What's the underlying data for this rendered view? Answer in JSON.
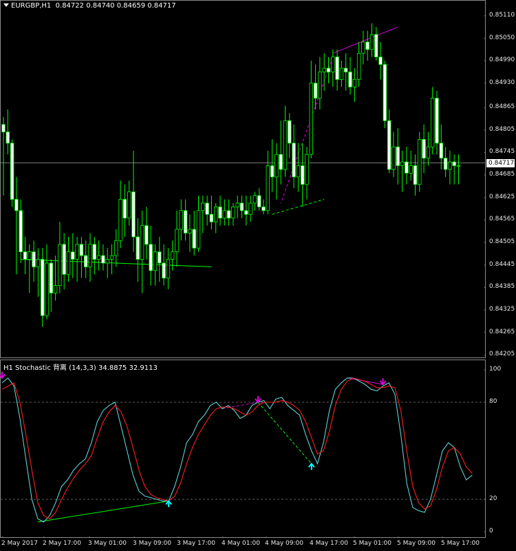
{
  "main_window": {
    "symbol": "EURGBP,H1",
    "ohlc": "0.84722 0.84740 0.84659 0.84717",
    "current_price": "0.84717",
    "price_axis": [
      "0.85110",
      "0.85050",
      "0.84990",
      "0.84930",
      "0.84865",
      "0.84805",
      "0.84745",
      "0.84685",
      "0.84625",
      "0.84565",
      "0.84505",
      "0.84445",
      "0.84385",
      "0.84325",
      "0.84265",
      "0.84205"
    ]
  },
  "indicator_window": {
    "title": "H1 Stochastic 背离 (14,3,3) 34.8875 32.9113",
    "levels": [
      "100",
      "80",
      "20",
      "0"
    ]
  },
  "time_axis": [
    "2 May 2017",
    "2 May 17:00",
    "3 May 01:00",
    "3 May 09:00",
    "3 May 17:00",
    "4 May 01:00",
    "4 May 09:00",
    "4 May 17:00",
    "5 May 01:00",
    "5 May 09:00",
    "5 May 17:00"
  ],
  "colors": {
    "background": "#000000",
    "candle_outline": "#00ff00",
    "candle_bull_fill": "#000000",
    "candle_bear_fill": "#ffffff",
    "stoch_main": "#5fd3d3",
    "stoch_signal": "#ff2020",
    "bearish_divergence": "#e000e0",
    "bullish_divergence": "#00ff00",
    "bullish_arrow": "#00ffff"
  },
  "chart_data": [
    {
      "type": "candlestick",
      "title": "EURGBP,H1",
      "ylim": [
        0.842,
        0.8513
      ],
      "candles": [
        {
          "o": 0.8482,
          "h": 0.8484,
          "l": 0.8463,
          "c": 0.848
        },
        {
          "o": 0.848,
          "h": 0.8486,
          "l": 0.8474,
          "c": 0.8477
        },
        {
          "o": 0.8477,
          "h": 0.8478,
          "l": 0.846,
          "c": 0.8462
        },
        {
          "o": 0.8462,
          "h": 0.8468,
          "l": 0.8442,
          "c": 0.8459
        },
        {
          "o": 0.8459,
          "h": 0.8462,
          "l": 0.8445,
          "c": 0.8448
        },
        {
          "o": 0.8448,
          "h": 0.8452,
          "l": 0.8442,
          "c": 0.8446
        },
        {
          "o": 0.8446,
          "h": 0.845,
          "l": 0.8437,
          "c": 0.8448
        },
        {
          "o": 0.8448,
          "h": 0.8451,
          "l": 0.844,
          "c": 0.8444
        },
        {
          "o": 0.8444,
          "h": 0.8449,
          "l": 0.8436,
          "c": 0.8446
        },
        {
          "o": 0.8446,
          "h": 0.8449,
          "l": 0.8428,
          "c": 0.8431
        },
        {
          "o": 0.8431,
          "h": 0.845,
          "l": 0.843,
          "c": 0.8445
        },
        {
          "o": 0.8445,
          "h": 0.8446,
          "l": 0.8432,
          "c": 0.8437
        },
        {
          "o": 0.8437,
          "h": 0.8447,
          "l": 0.8435,
          "c": 0.8439
        },
        {
          "o": 0.8439,
          "h": 0.8456,
          "l": 0.8437,
          "c": 0.845
        },
        {
          "o": 0.845,
          "h": 0.8453,
          "l": 0.8438,
          "c": 0.8442
        },
        {
          "o": 0.8442,
          "h": 0.8452,
          "l": 0.844,
          "c": 0.8448
        },
        {
          "o": 0.8448,
          "h": 0.8453,
          "l": 0.8441,
          "c": 0.8446
        },
        {
          "o": 0.8446,
          "h": 0.8452,
          "l": 0.844,
          "c": 0.845
        },
        {
          "o": 0.845,
          "h": 0.8452,
          "l": 0.8441,
          "c": 0.8447
        },
        {
          "o": 0.8447,
          "h": 0.8451,
          "l": 0.8441,
          "c": 0.8444
        },
        {
          "o": 0.8444,
          "h": 0.8453,
          "l": 0.844,
          "c": 0.845
        },
        {
          "o": 0.845,
          "h": 0.8452,
          "l": 0.8442,
          "c": 0.8446
        },
        {
          "o": 0.8446,
          "h": 0.8451,
          "l": 0.8443,
          "c": 0.8447
        },
        {
          "o": 0.8447,
          "h": 0.845,
          "l": 0.8443,
          "c": 0.8445
        },
        {
          "o": 0.8445,
          "h": 0.8449,
          "l": 0.8441,
          "c": 0.8446
        },
        {
          "o": 0.8446,
          "h": 0.845,
          "l": 0.8442,
          "c": 0.8447
        },
        {
          "o": 0.8447,
          "h": 0.8454,
          "l": 0.8444,
          "c": 0.8451
        },
        {
          "o": 0.8451,
          "h": 0.8467,
          "l": 0.8449,
          "c": 0.8462
        },
        {
          "o": 0.8462,
          "h": 0.8466,
          "l": 0.8452,
          "c": 0.8457
        },
        {
          "o": 0.8457,
          "h": 0.8467,
          "l": 0.8455,
          "c": 0.8464
        },
        {
          "o": 0.8464,
          "h": 0.8475,
          "l": 0.8448,
          "c": 0.8452
        },
        {
          "o": 0.8452,
          "h": 0.8457,
          "l": 0.844,
          "c": 0.8446
        },
        {
          "o": 0.8446,
          "h": 0.8459,
          "l": 0.8437,
          "c": 0.8455
        },
        {
          "o": 0.8455,
          "h": 0.846,
          "l": 0.8446,
          "c": 0.845
        },
        {
          "o": 0.845,
          "h": 0.8455,
          "l": 0.8439,
          "c": 0.8443
        },
        {
          "o": 0.8443,
          "h": 0.845,
          "l": 0.8439,
          "c": 0.8448
        },
        {
          "o": 0.8448,
          "h": 0.8452,
          "l": 0.844,
          "c": 0.8445
        },
        {
          "o": 0.8445,
          "h": 0.845,
          "l": 0.8439,
          "c": 0.8441
        },
        {
          "o": 0.8441,
          "h": 0.8449,
          "l": 0.8438,
          "c": 0.8446
        },
        {
          "o": 0.8446,
          "h": 0.8451,
          "l": 0.8443,
          "c": 0.8448
        },
        {
          "o": 0.8448,
          "h": 0.8459,
          "l": 0.8444,
          "c": 0.8454
        },
        {
          "o": 0.8454,
          "h": 0.8462,
          "l": 0.8451,
          "c": 0.8459
        },
        {
          "o": 0.8459,
          "h": 0.8462,
          "l": 0.8451,
          "c": 0.8453
        },
        {
          "o": 0.8453,
          "h": 0.8458,
          "l": 0.8448,
          "c": 0.8454
        },
        {
          "o": 0.8454,
          "h": 0.8459,
          "l": 0.8447,
          "c": 0.8449
        },
        {
          "o": 0.8449,
          "h": 0.8463,
          "l": 0.8448,
          "c": 0.8459
        },
        {
          "o": 0.8459,
          "h": 0.8463,
          "l": 0.8453,
          "c": 0.8461
        },
        {
          "o": 0.8461,
          "h": 0.8463,
          "l": 0.8455,
          "c": 0.8458
        },
        {
          "o": 0.8458,
          "h": 0.8463,
          "l": 0.8454,
          "c": 0.8456
        },
        {
          "o": 0.8456,
          "h": 0.8461,
          "l": 0.8453,
          "c": 0.846
        },
        {
          "o": 0.846,
          "h": 0.8463,
          "l": 0.8455,
          "c": 0.8457
        },
        {
          "o": 0.8457,
          "h": 0.8462,
          "l": 0.8455,
          "c": 0.8459
        },
        {
          "o": 0.8459,
          "h": 0.8462,
          "l": 0.8455,
          "c": 0.8457
        },
        {
          "o": 0.8457,
          "h": 0.8461,
          "l": 0.8455,
          "c": 0.846
        },
        {
          "o": 0.846,
          "h": 0.8463,
          "l": 0.8457,
          "c": 0.8461
        },
        {
          "o": 0.8461,
          "h": 0.8463,
          "l": 0.8457,
          "c": 0.8459
        },
        {
          "o": 0.8459,
          "h": 0.8463,
          "l": 0.8455,
          "c": 0.8458
        },
        {
          "o": 0.8458,
          "h": 0.8463,
          "l": 0.8456,
          "c": 0.8461
        },
        {
          "o": 0.8461,
          "h": 0.8464,
          "l": 0.8459,
          "c": 0.8463
        },
        {
          "o": 0.8463,
          "h": 0.8465,
          "l": 0.8459,
          "c": 0.846
        },
        {
          "o": 0.846,
          "h": 0.8462,
          "l": 0.8458,
          "c": 0.8459
        },
        {
          "o": 0.8459,
          "h": 0.8475,
          "l": 0.8458,
          "c": 0.8471
        },
        {
          "o": 0.8471,
          "h": 0.8478,
          "l": 0.8464,
          "c": 0.8468
        },
        {
          "o": 0.8468,
          "h": 0.8477,
          "l": 0.8462,
          "c": 0.8474
        },
        {
          "o": 0.8474,
          "h": 0.8483,
          "l": 0.8466,
          "c": 0.847
        },
        {
          "o": 0.847,
          "h": 0.8487,
          "l": 0.8468,
          "c": 0.8483
        },
        {
          "o": 0.8483,
          "h": 0.8485,
          "l": 0.8473,
          "c": 0.8477
        },
        {
          "o": 0.8477,
          "h": 0.8482,
          "l": 0.8465,
          "c": 0.8468
        },
        {
          "o": 0.8468,
          "h": 0.8477,
          "l": 0.8464,
          "c": 0.8471
        },
        {
          "o": 0.8471,
          "h": 0.8477,
          "l": 0.846,
          "c": 0.8466
        },
        {
          "o": 0.8466,
          "h": 0.8476,
          "l": 0.8462,
          "c": 0.8474
        },
        {
          "o": 0.8474,
          "h": 0.8499,
          "l": 0.8473,
          "c": 0.8493
        },
        {
          "o": 0.8493,
          "h": 0.8498,
          "l": 0.8486,
          "c": 0.8489
        },
        {
          "o": 0.8489,
          "h": 0.85,
          "l": 0.8486,
          "c": 0.8496
        },
        {
          "o": 0.8496,
          "h": 0.8501,
          "l": 0.8491,
          "c": 0.8497
        },
        {
          "o": 0.8497,
          "h": 0.85,
          "l": 0.8493,
          "c": 0.8496
        },
        {
          "o": 0.8496,
          "h": 0.8502,
          "l": 0.8492,
          "c": 0.85
        },
        {
          "o": 0.85,
          "h": 0.8502,
          "l": 0.8491,
          "c": 0.8494
        },
        {
          "o": 0.8494,
          "h": 0.8499,
          "l": 0.8492,
          "c": 0.8497
        },
        {
          "o": 0.8497,
          "h": 0.8501,
          "l": 0.8491,
          "c": 0.8496
        },
        {
          "o": 0.8496,
          "h": 0.85,
          "l": 0.849,
          "c": 0.8492
        },
        {
          "o": 0.8492,
          "h": 0.8497,
          "l": 0.8488,
          "c": 0.8494
        },
        {
          "o": 0.8494,
          "h": 0.8504,
          "l": 0.8492,
          "c": 0.8501
        },
        {
          "o": 0.8501,
          "h": 0.8507,
          "l": 0.8498,
          "c": 0.8504
        },
        {
          "o": 0.8504,
          "h": 0.8507,
          "l": 0.8499,
          "c": 0.8502
        },
        {
          "o": 0.8502,
          "h": 0.8509,
          "l": 0.85,
          "c": 0.8506
        },
        {
          "o": 0.8506,
          "h": 0.8508,
          "l": 0.8499,
          "c": 0.85
        },
        {
          "o": 0.85,
          "h": 0.8504,
          "l": 0.8494,
          "c": 0.8498
        },
        {
          "o": 0.8498,
          "h": 0.8499,
          "l": 0.8481,
          "c": 0.8483
        },
        {
          "o": 0.8483,
          "h": 0.8486,
          "l": 0.8469,
          "c": 0.847
        },
        {
          "o": 0.847,
          "h": 0.848,
          "l": 0.8468,
          "c": 0.8476
        },
        {
          "o": 0.8476,
          "h": 0.8481,
          "l": 0.8466,
          "c": 0.8471
        },
        {
          "o": 0.8471,
          "h": 0.8475,
          "l": 0.8464,
          "c": 0.8472
        },
        {
          "o": 0.8472,
          "h": 0.8476,
          "l": 0.8466,
          "c": 0.8469
        },
        {
          "o": 0.8469,
          "h": 0.8475,
          "l": 0.8467,
          "c": 0.8471
        },
        {
          "o": 0.8471,
          "h": 0.8474,
          "l": 0.8463,
          "c": 0.8466
        },
        {
          "o": 0.8466,
          "h": 0.848,
          "l": 0.8464,
          "c": 0.8478
        },
        {
          "o": 0.8478,
          "h": 0.8482,
          "l": 0.8469,
          "c": 0.8473
        },
        {
          "o": 0.8473,
          "h": 0.848,
          "l": 0.8471,
          "c": 0.8476
        },
        {
          "o": 0.8476,
          "h": 0.8492,
          "l": 0.8474,
          "c": 0.8489
        },
        {
          "o": 0.8489,
          "h": 0.8491,
          "l": 0.8474,
          "c": 0.8477
        },
        {
          "o": 0.8477,
          "h": 0.8482,
          "l": 0.847,
          "c": 0.8473
        },
        {
          "o": 0.8473,
          "h": 0.8476,
          "l": 0.8468,
          "c": 0.847
        },
        {
          "o": 0.847,
          "h": 0.8475,
          "l": 0.8466,
          "c": 0.8472
        },
        {
          "o": 0.8472,
          "h": 0.8474,
          "l": 0.8466,
          "c": 0.8471
        },
        {
          "o": 0.8471,
          "h": 0.8474,
          "l": 0.8466,
          "c": 0.8471
        }
      ],
      "trendlines": [
        {
          "kind": "bullish",
          "style": "solid",
          "from": [
            4,
            0.8446
          ],
          "to": [
            48,
            0.8444
          ]
        },
        {
          "kind": "bearish",
          "style": "dashed",
          "from": [
            76,
            0.85
          ],
          "to": [
            64,
            0.8461
          ]
        },
        {
          "kind": "bearish",
          "style": "solid",
          "from": [
            76,
            0.8501
          ],
          "to": [
            91,
            0.8508
          ]
        },
        {
          "kind": "bullish",
          "style": "dashed",
          "from": [
            62,
            0.8458
          ],
          "to": [
            74,
            0.8462
          ]
        }
      ]
    },
    {
      "type": "line",
      "title": "H1 Stochastic 背离 (14,3,3) 34.8875 32.9113",
      "ylim": [
        0,
        100
      ],
      "levels": [
        80,
        20
      ],
      "series": [
        {
          "name": "main",
          "values": [
            92,
            95,
            90,
            70,
            45,
            20,
            8,
            6,
            10,
            18,
            28,
            32,
            38,
            42,
            45,
            55,
            68,
            75,
            78,
            80,
            65,
            50,
            35,
            25,
            22,
            21,
            20,
            19,
            19,
            28,
            40,
            55,
            60,
            68,
            72,
            78,
            80,
            76,
            78,
            75,
            70,
            72,
            78,
            80,
            81,
            76,
            82,
            83,
            78,
            75,
            72,
            60,
            50,
            42,
            55,
            75,
            88,
            92,
            95,
            95,
            93,
            91,
            88,
            87,
            90,
            92,
            85,
            60,
            30,
            15,
            13,
            12,
            20,
            35,
            50,
            55,
            52,
            40,
            32,
            35
          ]
        },
        {
          "name": "signal",
          "values": [
            88,
            90,
            92,
            80,
            60,
            38,
            18,
            10,
            8,
            12,
            20,
            27,
            33,
            38,
            42,
            47,
            58,
            68,
            74,
            78,
            74,
            65,
            52,
            38,
            28,
            23,
            21,
            20,
            19,
            22,
            30,
            42,
            52,
            60,
            66,
            72,
            76,
            77,
            77,
            76,
            74,
            72,
            74,
            78,
            80,
            80,
            80,
            81,
            80,
            78,
            75,
            68,
            58,
            48,
            50,
            62,
            78,
            88,
            93,
            95,
            94,
            93,
            91,
            89,
            89,
            90,
            89,
            75,
            50,
            28,
            18,
            14,
            16,
            26,
            40,
            50,
            52,
            48,
            40,
            36
          ]
        }
      ],
      "markers": [
        {
          "kind": "bearish",
          "index": 0,
          "value": 95
        },
        {
          "kind": "bullish",
          "index": 28,
          "value": 19
        },
        {
          "kind": "bearish",
          "index": 43,
          "value": 80
        },
        {
          "kind": "bullish",
          "index": 52,
          "value": 42
        },
        {
          "kind": "bearish",
          "index": 64,
          "value": 91
        }
      ],
      "divergence_lines": [
        {
          "kind": "bullish",
          "style": "solid",
          "from": [
            6,
            6
          ],
          "to": [
            28,
            19
          ]
        },
        {
          "kind": "bearish",
          "style": "dashed",
          "from": [
            37,
            76
          ],
          "to": [
            43,
            80
          ]
        },
        {
          "kind": "bullish",
          "style": "dashed",
          "from": [
            43,
            80
          ],
          "to": [
            52,
            42
          ]
        },
        {
          "kind": "bearish",
          "style": "solid",
          "from": [
            58,
            95
          ],
          "to": [
            64,
            91
          ]
        }
      ]
    }
  ]
}
